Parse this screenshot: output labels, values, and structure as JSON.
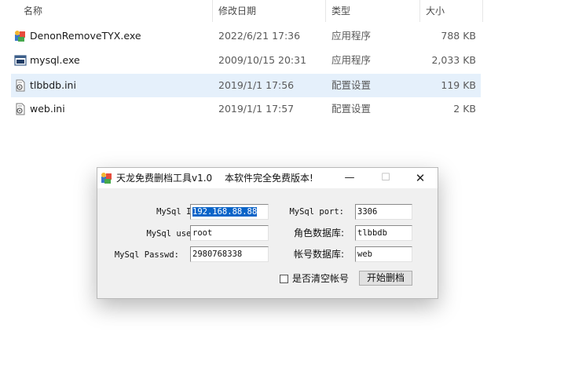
{
  "columns": {
    "name": "名称",
    "modified": "修改日期",
    "type": "类型",
    "size": "大小"
  },
  "files": [
    {
      "name": "DenonRemoveTYX.exe",
      "modified": "2022/6/21 17:36",
      "type": "应用程序",
      "size": "788 KB",
      "icon": "installer-exe-icon"
    },
    {
      "name": "mysql.exe",
      "modified": "2009/10/15 20:31",
      "type": "应用程序",
      "size": "2,033 KB",
      "icon": "console-exe-icon"
    },
    {
      "name": "tlbbdb.ini",
      "modified": "2019/1/1 17:56",
      "type": "配置设置",
      "size": "119 KB",
      "icon": "ini-file-icon"
    },
    {
      "name": "web.ini",
      "modified": "2019/1/1 17:57",
      "type": "配置设置",
      "size": "2 KB",
      "icon": "ini-file-icon"
    }
  ],
  "dialog": {
    "title": "天龙免费删档工具v1.0",
    "subtitle": "本软件完全免费版本!",
    "window_controls": {
      "minimize": "—",
      "maximize": "☐",
      "close": "✕"
    },
    "fields": {
      "ip": {
        "label": "MySql IP:",
        "value": "192.168.88.88"
      },
      "user": {
        "label": "MySql user:",
        "value": "root"
      },
      "passwd": {
        "label": "MySql Passwd:",
        "value": "2980768338"
      },
      "port": {
        "label": "MySql port:",
        "value": "3306"
      },
      "role_db": {
        "label": "角色数据库:",
        "value": "tlbbdb"
      },
      "account_db": {
        "label": "帐号数据库:",
        "value": "web"
      }
    },
    "clear_accounts": {
      "label": "是否清空帐号",
      "checked": false
    },
    "start_button": "开始删档"
  }
}
